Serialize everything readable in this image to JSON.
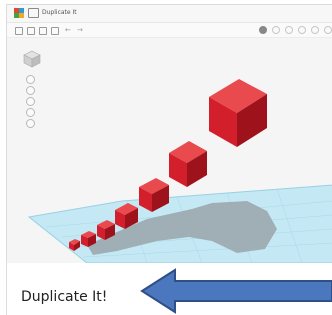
{
  "app": {
    "title": "Duplicate It!",
    "window_title": "Duplicate It"
  },
  "caption": {
    "text": "Duplicate It!"
  },
  "colors": {
    "cube_front": "#d21f2b",
    "cube_top": "#e84a4e",
    "cube_side": "#9e121c",
    "workplane": "#bfe6f2",
    "grid_line": "#8fcde2",
    "shadow": "#9ea8ae",
    "arrow_fill": "#4b77be",
    "arrow_stroke": "#2f4f86"
  },
  "icons": {
    "logo": "tinkercad-logo",
    "viewcube": "view-cube-icon",
    "pointer": "left-arrow-icon"
  }
}
